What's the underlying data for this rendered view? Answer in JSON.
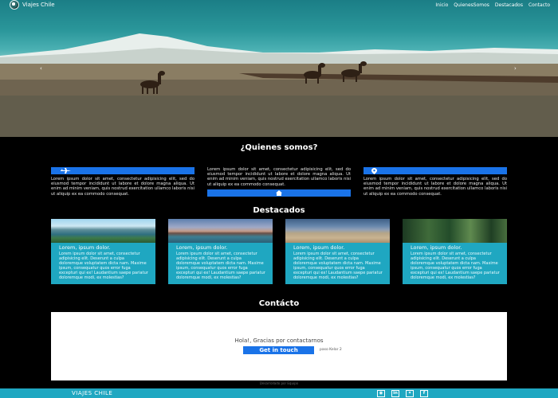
{
  "nav": {
    "brand": "Viajes Chile",
    "items": [
      {
        "label": "Inicio"
      },
      {
        "label": "QuienesSomos"
      },
      {
        "label": "Destacados"
      },
      {
        "label": "Contacto"
      }
    ]
  },
  "about": {
    "title": "¿Quienes somos?",
    "paragraph": "Lorem ipsum dolor sit amet, consectetur adipisicing elit, sed do eiusmod tempor incididunt ut labore et dolore magna aliqua. Ut enim ad minim veniam, quis nostrud exercitation ullamco laboris nisi ut aliquip ex ea commodo consequat."
  },
  "featured": {
    "title": "Destacados",
    "cards": [
      {
        "title": "Lorem, ipsum dolor.",
        "text": "Lorem ipsum dolor sit amet, consectetur adipisicing elit. Deserunt a culpa doloremque voluptatem dicta nam. Maxime ipsum, consequatur quos error fuga excepturi qui ex! Laudantium saepe pariatur doloremque modi, ex molestias?"
      },
      {
        "title": "Lorem, ipsum dolor.",
        "text": "Lorem ipsum dolor sit amet, consectetur adipisicing elit. Deserunt a culpa doloremque voluptatem dicta nam. Maxime ipsum, consequatur quos error fuga excepturi qui ex! Laudantium saepe pariatur doloremque modi, ex molestias?"
      },
      {
        "title": "Lorem, ipsum dolor.",
        "text": "Lorem ipsum dolor sit amet, consectetur adipisicing elit. Deserunt a culpa doloremque voluptatem dicta nam. Maxime ipsum, consequatur quos error fuga excepturi qui ex! Laudantium saepe pariatur doloremque modi, ex molestias?"
      },
      {
        "title": "Lorem, ipsum dolor.",
        "text": "Lorem ipsum dolor sit amet, consectetur adipisicing elit. Deserunt a culpa doloremque voluptatem dicta nam. Maxime ipsum, consequatur quos error fuga excepturi qui ex! Laudantium saepe pariatur doloremque modi, ex molestias?"
      }
    ]
  },
  "contact": {
    "title": "Contácto",
    "message": "Hola!, Gracias por contactarnos",
    "button": "Get in touch",
    "helper": "paso Kelar 2"
  },
  "credit": "Desarrollado por Equipo",
  "footer": {
    "brand": "VIAJES CHILE"
  },
  "icons": [
    "logo-icon",
    "airplane-icon",
    "home-icon",
    "location-pin-icon",
    "instagram-icon",
    "linkedin-icon",
    "twitter-icon",
    "facebook-icon",
    "arrow-left-icon",
    "arrow-right-icon"
  ],
  "colors": {
    "accent": "#1a73e8",
    "teal": "#1fa7c1",
    "background": "#000000"
  }
}
